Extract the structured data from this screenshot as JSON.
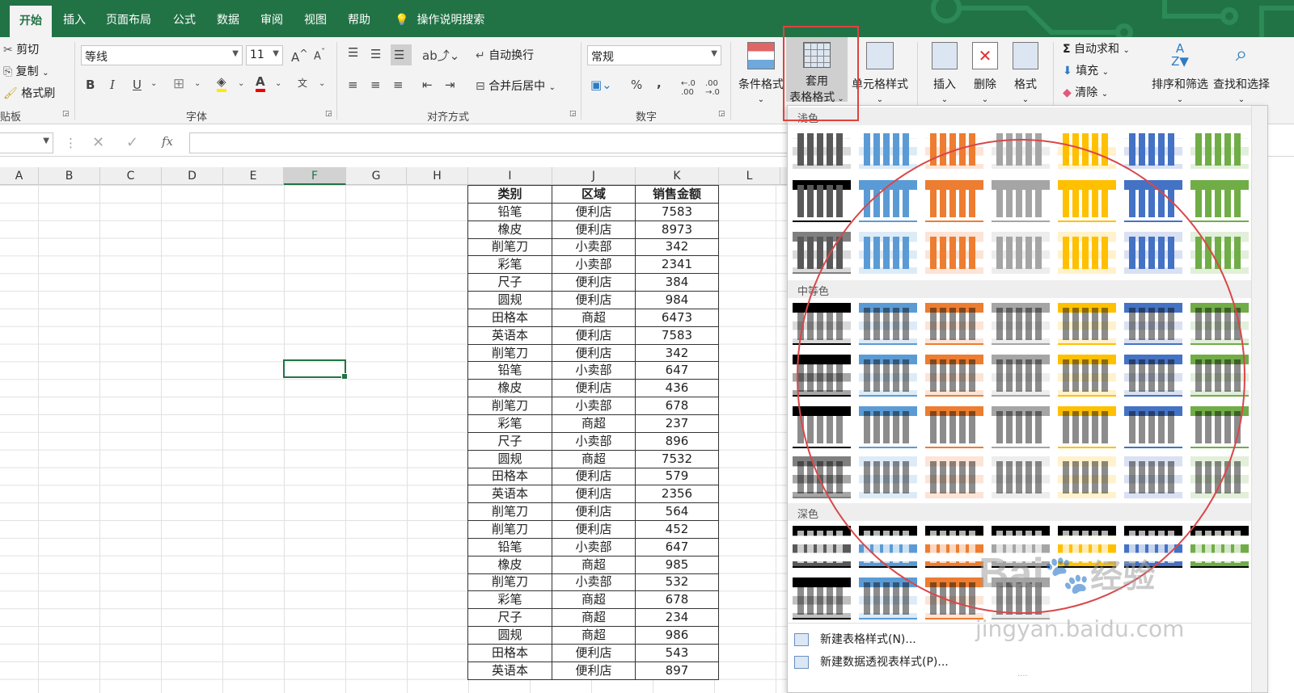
{
  "tabs": [
    "开始",
    "插入",
    "页面布局",
    "公式",
    "数据",
    "审阅",
    "视图",
    "帮助"
  ],
  "tell_me": "操作说明搜索",
  "clipboard": {
    "cut": "剪切",
    "copy": "复制",
    "painter": "格式刷",
    "group": "贴板"
  },
  "font": {
    "name": "等线",
    "size": "11",
    "bold": "B",
    "italic": "I",
    "underline": "U",
    "grow": "A",
    "shrink": "A",
    "font_color": "A",
    "phonetic": "文",
    "group": "字体"
  },
  "alignment": {
    "wrap": "自动换行",
    "merge": "合并后居中",
    "group": "对齐方式"
  },
  "number": {
    "format": "常规",
    "percent": "%",
    "comma": ",",
    "group": "数字"
  },
  "styles": {
    "conditional": "条件格式",
    "table_line1": "套用",
    "table_line2": "表格格式",
    "cell_styles": "单元格样式"
  },
  "cells": {
    "insert": "插入",
    "delete": "删除",
    "format": "格式"
  },
  "editing": {
    "autosum": "自动求和",
    "fill": "填充",
    "clear": "清除",
    "sort": "排序和筛选",
    "find": "查找和选择"
  },
  "formula_bar": {
    "fx": "fx"
  },
  "columns": [
    "A",
    "B",
    "C",
    "D",
    "E",
    "F",
    "G",
    "H",
    "I",
    "J",
    "K",
    "L"
  ],
  "table": {
    "headers": [
      "类别",
      "区域",
      "销售金额"
    ],
    "rows": [
      [
        "铅笔",
        "便利店",
        "7583"
      ],
      [
        "橡皮",
        "便利店",
        "8973"
      ],
      [
        "削笔刀",
        "小卖部",
        "342"
      ],
      [
        "彩笔",
        "小卖部",
        "2341"
      ],
      [
        "尺子",
        "便利店",
        "384"
      ],
      [
        "圆规",
        "便利店",
        "984"
      ],
      [
        "田格本",
        "商超",
        "6473"
      ],
      [
        "英语本",
        "便利店",
        "7583"
      ],
      [
        "削笔刀",
        "便利店",
        "342"
      ],
      [
        "铅笔",
        "小卖部",
        "647"
      ],
      [
        "橡皮",
        "便利店",
        "436"
      ],
      [
        "削笔刀",
        "小卖部",
        "678"
      ],
      [
        "彩笔",
        "商超",
        "237"
      ],
      [
        "尺子",
        "小卖部",
        "896"
      ],
      [
        "圆规",
        "商超",
        "7532"
      ],
      [
        "田格本",
        "便利店",
        "579"
      ],
      [
        "英语本",
        "便利店",
        "2356"
      ],
      [
        "削笔刀",
        "便利店",
        "564"
      ],
      [
        "削笔刀",
        "便利店",
        "452"
      ],
      [
        "铅笔",
        "小卖部",
        "647"
      ],
      [
        "橡皮",
        "商超",
        "985"
      ],
      [
        "削笔刀",
        "小卖部",
        "532"
      ],
      [
        "彩笔",
        "商超",
        "678"
      ],
      [
        "尺子",
        "商超",
        "234"
      ],
      [
        "圆规",
        "商超",
        "986"
      ],
      [
        "田格本",
        "便利店",
        "543"
      ],
      [
        "英语本",
        "便利店",
        "897"
      ]
    ]
  },
  "gallery": {
    "light": "浅色",
    "medium": "中等色",
    "dark": "深色",
    "new_table_style": "新建表格样式(N)...",
    "new_pivot_style": "新建数据透视表样式(P)...",
    "palette": [
      "#595959",
      "#5b9bd5",
      "#ed7d31",
      "#a5a5a5",
      "#ffc000",
      "#4472c4",
      "#70ad47"
    ],
    "tints": [
      "#d9d9d9",
      "#ddebf7",
      "#fce4d6",
      "#ededed",
      "#fff2cc",
      "#d9e1f2",
      "#e2efda"
    ]
  },
  "watermark": {
    "brand": "Bai",
    "brand2": "经验",
    "url": "jingyan.baidu.com"
  }
}
